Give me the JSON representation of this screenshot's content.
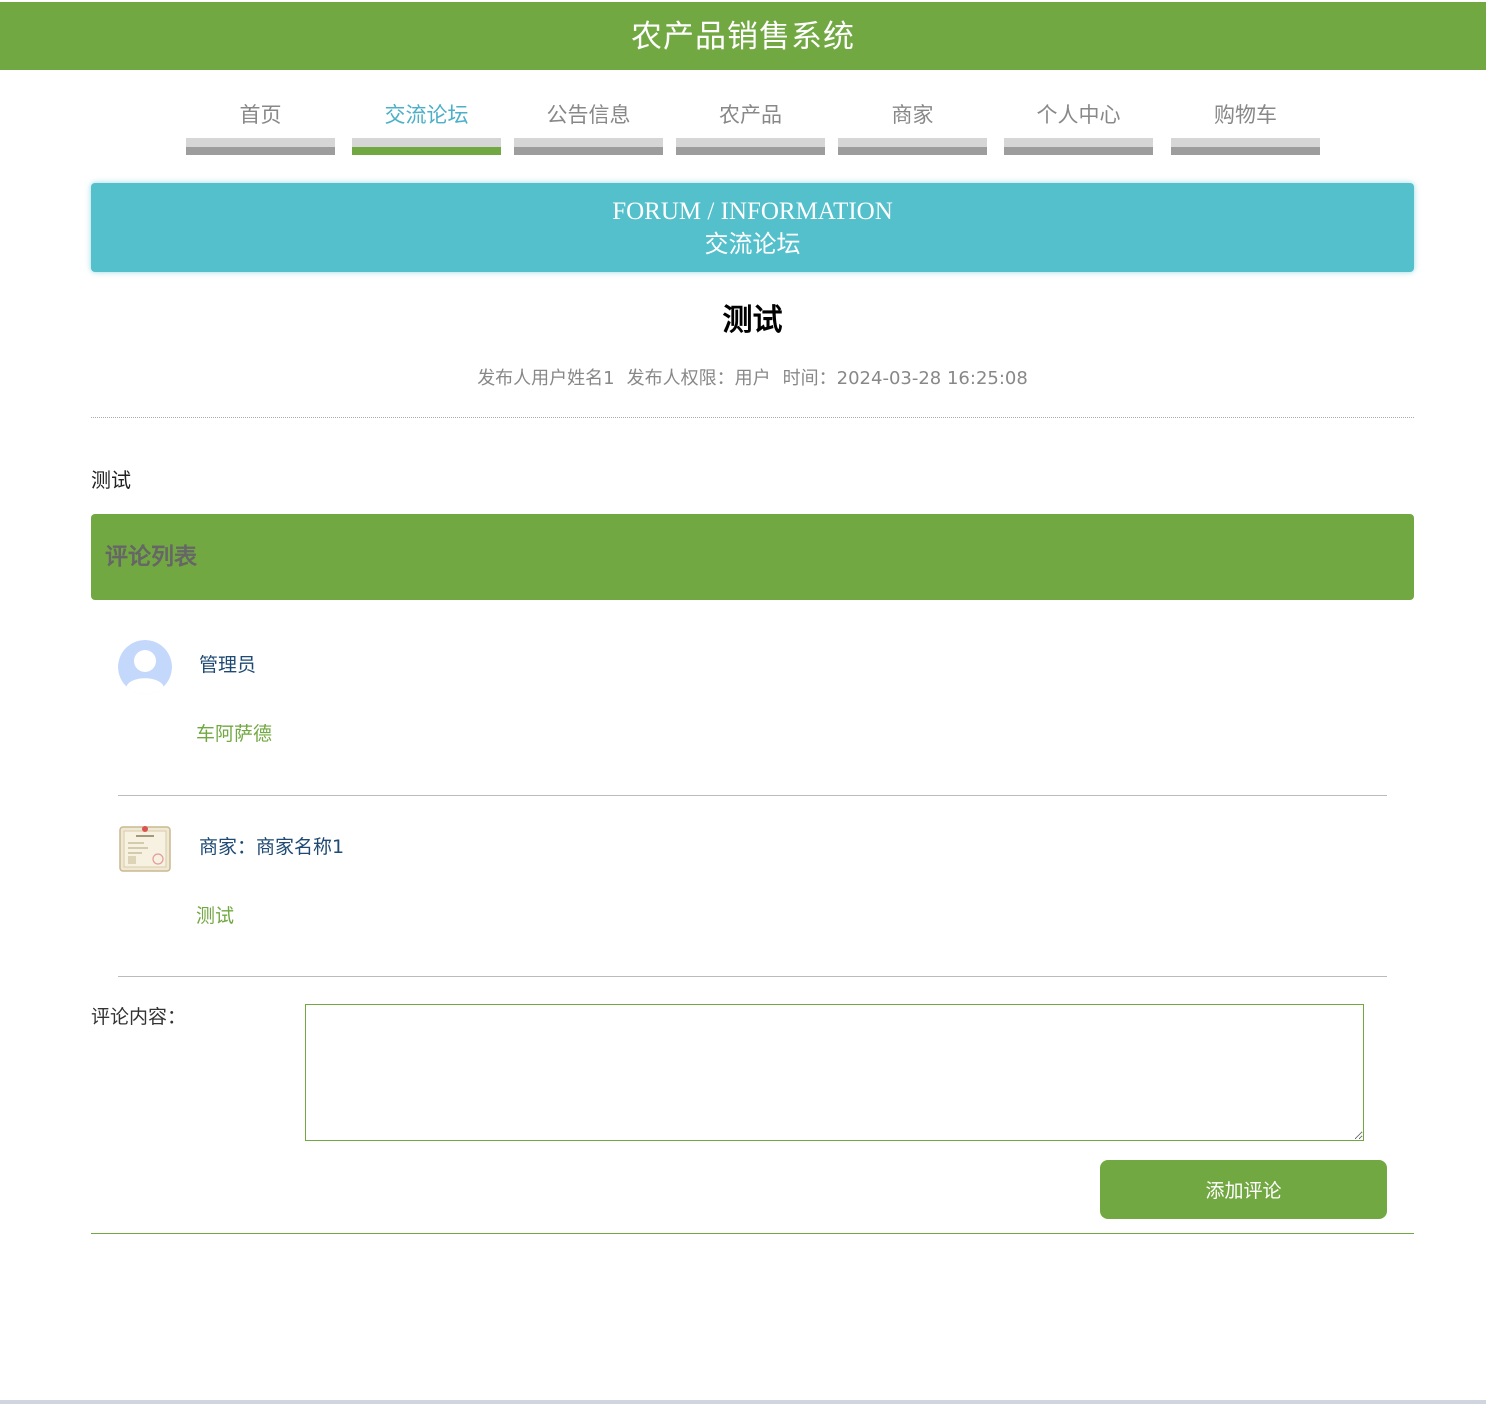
{
  "header": {
    "title": "农产品销售系统"
  },
  "nav": {
    "items": [
      {
        "label": "首页"
      },
      {
        "label": "交流论坛"
      },
      {
        "label": "公告信息"
      },
      {
        "label": "农产品"
      },
      {
        "label": "商家"
      },
      {
        "label": "个人中心"
      },
      {
        "label": "购物车"
      }
    ],
    "active": "交流论坛"
  },
  "banner": {
    "en": "FORUM / INFORMATION",
    "cn": "交流论坛"
  },
  "post": {
    "title": "测试",
    "author": "发布人用户姓名1",
    "role": "发布人权限：用户",
    "time": "时间：2024-03-28 16:25:08",
    "content": "测试"
  },
  "comments": {
    "header": "评论列表",
    "items": [
      {
        "name": "管理员",
        "text": "车阿萨德",
        "avatar_icon": "user-avatar-icon"
      },
      {
        "name": "商家：商家名称1",
        "text": "测试",
        "avatar_icon": "certificate-avatar-icon"
      }
    ]
  },
  "form": {
    "label": "评论内容：",
    "placeholder": "",
    "submit_label": "添加评论"
  },
  "colors": {
    "primary": "#72a842",
    "accent": "#54c0cc",
    "link": "#1e4a73"
  }
}
